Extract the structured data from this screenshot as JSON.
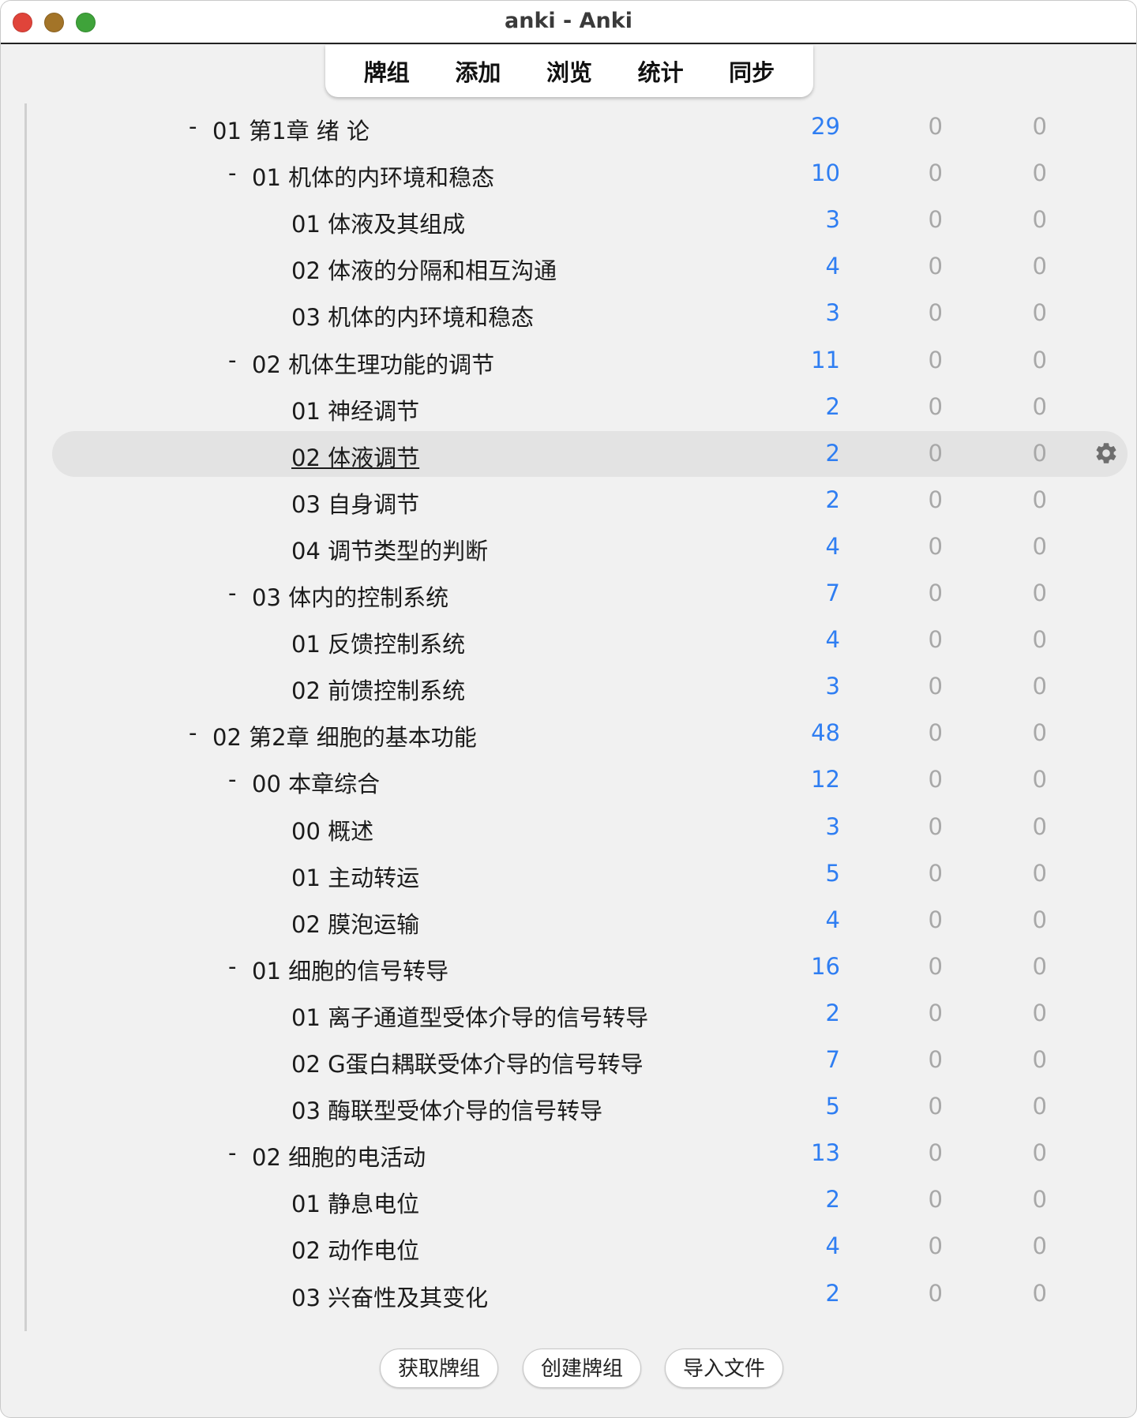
{
  "window": {
    "title": "anki - Anki"
  },
  "toolbar": {
    "items": [
      "牌组",
      "添加",
      "浏览",
      "统计",
      "同步"
    ]
  },
  "decks": [
    {
      "name": "01 第1章 绪 论",
      "level": 0,
      "collapsible": true,
      "new": "29",
      "learn": "0",
      "due": "0"
    },
    {
      "name": "01 机体的内环境和稳态",
      "level": 1,
      "collapsible": true,
      "new": "10",
      "learn": "0",
      "due": "0"
    },
    {
      "name": "01 体液及其组成",
      "level": 2,
      "collapsible": false,
      "new": "3",
      "learn": "0",
      "due": "0"
    },
    {
      "name": "02 体液的分隔和相互沟通",
      "level": 2,
      "collapsible": false,
      "new": "4",
      "learn": "0",
      "due": "0"
    },
    {
      "name": "03 机体的内环境和稳态",
      "level": 2,
      "collapsible": false,
      "new": "3",
      "learn": "0",
      "due": "0"
    },
    {
      "name": "02 机体生理功能的调节",
      "level": 1,
      "collapsible": true,
      "new": "11",
      "learn": "0",
      "due": "0"
    },
    {
      "name": "01 神经调节",
      "level": 2,
      "collapsible": false,
      "new": "2",
      "learn": "0",
      "due": "0"
    },
    {
      "name": "02 体液调节",
      "level": 2,
      "collapsible": false,
      "new": "2",
      "learn": "0",
      "due": "0",
      "selected": true
    },
    {
      "name": "03 自身调节",
      "level": 2,
      "collapsible": false,
      "new": "2",
      "learn": "0",
      "due": "0"
    },
    {
      "name": "04 调节类型的判断",
      "level": 2,
      "collapsible": false,
      "new": "4",
      "learn": "0",
      "due": "0"
    },
    {
      "name": "03 体内的控制系统",
      "level": 1,
      "collapsible": true,
      "new": "7",
      "learn": "0",
      "due": "0"
    },
    {
      "name": "01 反馈控制系统",
      "level": 2,
      "collapsible": false,
      "new": "4",
      "learn": "0",
      "due": "0"
    },
    {
      "name": "02 前馈控制系统",
      "level": 2,
      "collapsible": false,
      "new": "3",
      "learn": "0",
      "due": "0"
    },
    {
      "name": "02 第2章 细胞的基本功能",
      "level": 0,
      "collapsible": true,
      "new": "48",
      "learn": "0",
      "due": "0"
    },
    {
      "name": "00 本章综合",
      "level": 1,
      "collapsible": true,
      "new": "12",
      "learn": "0",
      "due": "0"
    },
    {
      "name": "00 概述",
      "level": 2,
      "collapsible": false,
      "new": "3",
      "learn": "0",
      "due": "0"
    },
    {
      "name": "01 主动转运",
      "level": 2,
      "collapsible": false,
      "new": "5",
      "learn": "0",
      "due": "0"
    },
    {
      "name": "02 膜泡运输",
      "level": 2,
      "collapsible": false,
      "new": "4",
      "learn": "0",
      "due": "0"
    },
    {
      "name": "01 细胞的信号转导",
      "level": 1,
      "collapsible": true,
      "new": "16",
      "learn": "0",
      "due": "0"
    },
    {
      "name": "01 离子通道型受体介导的信号转导",
      "level": 2,
      "collapsible": false,
      "new": "2",
      "learn": "0",
      "due": "0"
    },
    {
      "name": "02 G蛋白耦联受体介导的信号转导",
      "level": 2,
      "collapsible": false,
      "new": "7",
      "learn": "0",
      "due": "0"
    },
    {
      "name": "03 酶联型受体介导的信号转导",
      "level": 2,
      "collapsible": false,
      "new": "5",
      "learn": "0",
      "due": "0"
    },
    {
      "name": "02 细胞的电活动",
      "level": 1,
      "collapsible": true,
      "new": "13",
      "learn": "0",
      "due": "0"
    },
    {
      "name": "01 静息电位",
      "level": 2,
      "collapsible": false,
      "new": "2",
      "learn": "0",
      "due": "0"
    },
    {
      "name": "02 动作电位",
      "level": 2,
      "collapsible": false,
      "new": "4",
      "learn": "0",
      "due": "0"
    },
    {
      "name": "03 兴奋性及其变化",
      "level": 2,
      "collapsible": false,
      "new": "2",
      "learn": "0",
      "due": "0"
    }
  ],
  "collapse_symbol": "-",
  "gear_icon": "gear-icon",
  "colors": {
    "new_count": "#2f7ef2",
    "zero_count": "#a8a8a8",
    "selected_row": "#e3e3e3"
  },
  "footer": {
    "get_shared": "获取牌组",
    "create_deck": "创建牌组",
    "import_file": "导入文件"
  }
}
